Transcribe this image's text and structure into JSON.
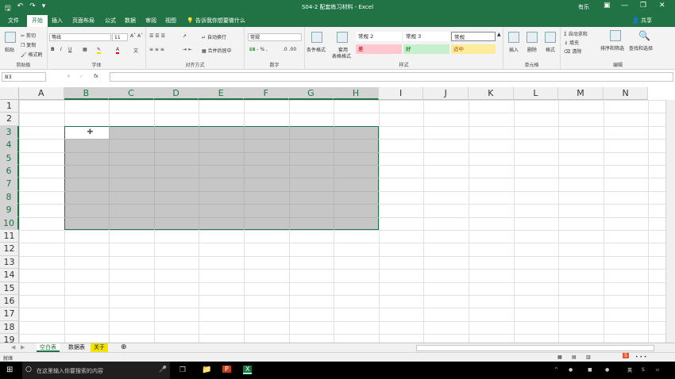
{
  "window": {
    "title": "S04-2 配套练习材料 - Excel",
    "user": "有乐"
  },
  "tabs": [
    {
      "label": "文件"
    },
    {
      "label": "开始"
    },
    {
      "label": "插入"
    },
    {
      "label": "页面布局"
    },
    {
      "label": "公式"
    },
    {
      "label": "数据"
    },
    {
      "label": "审阅"
    },
    {
      "label": "视图"
    }
  ],
  "tellme": "告诉我你想要做什么",
  "share": "共享",
  "ribbon": {
    "clipboard": {
      "paste": "粘贴",
      "cut": "剪切",
      "copy": "复制",
      "format_painter": "格式刷",
      "label": "剪贴板"
    },
    "font": {
      "name": "等线",
      "size": "11",
      "label": "字体"
    },
    "alignment": {
      "wrap": "自动换行",
      "merge": "合并后居中",
      "label": "对齐方式"
    },
    "number": {
      "format": "常规",
      "label": "数字"
    },
    "styles": {
      "conditional": "条件格式",
      "table_format_1": "套用",
      "table_format_2": "表格格式",
      "normal2": "常规 2",
      "normal3": "常规 3",
      "normal": "常规",
      "bad": "差",
      "good": "好",
      "neutral": "适中",
      "label": "样式"
    },
    "cells": {
      "insert": "插入",
      "delete": "删除",
      "format": "格式",
      "label": "单元格"
    },
    "editing": {
      "autosum": "自动求和",
      "fill": "填充",
      "clear": "清除",
      "sort": "排序和筛选",
      "find": "查找和选择",
      "label": "编辑"
    }
  },
  "formula_bar": {
    "name_box": "B3",
    "fx": "fx",
    "value": ""
  },
  "grid": {
    "columns": [
      "A",
      "B",
      "C",
      "D",
      "E",
      "F",
      "G",
      "H",
      "I",
      "J",
      "K",
      "L",
      "M",
      "N"
    ],
    "rows": [
      "1",
      "2",
      "3",
      "4",
      "5",
      "6",
      "7",
      "8",
      "9",
      "10",
      "11",
      "12",
      "13",
      "14",
      "15",
      "16",
      "17",
      "18",
      "19"
    ],
    "selection": "B3:H10"
  },
  "sheets": [
    {
      "label": "空白表",
      "active": true
    },
    {
      "label": "数据表",
      "active": false
    },
    {
      "label": "关于",
      "active": false
    }
  ],
  "status": {
    "ready": "就绪"
  },
  "taskbar": {
    "search_placeholder": "在这里输入你要搜索的内容"
  },
  "colors": {
    "accent": "#217346",
    "bad_bg": "#ffc7ce",
    "good_bg": "#c6efce",
    "neutral_bg": "#ffeb9c"
  }
}
